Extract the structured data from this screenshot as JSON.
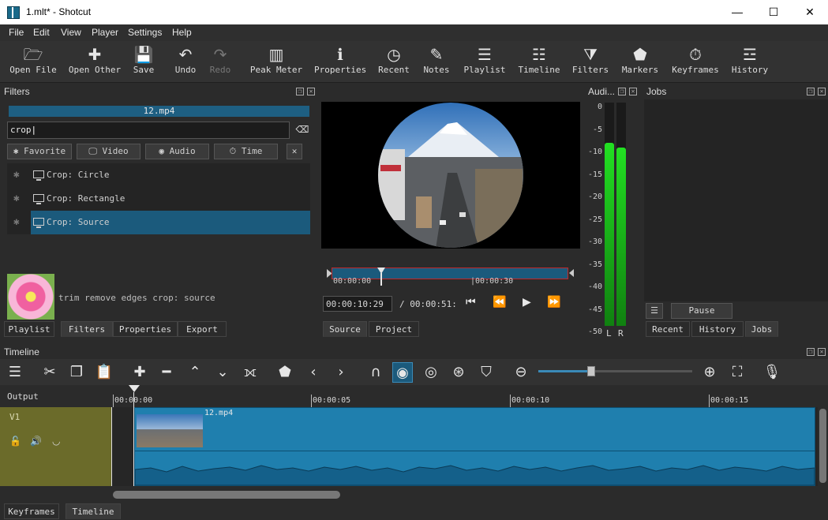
{
  "window": {
    "title": "1.mlt* - Shotcut",
    "minimize": "—",
    "maximize": "☐",
    "close": "✕"
  },
  "menu": [
    "File",
    "Edit",
    "View",
    "Player",
    "Settings",
    "Help"
  ],
  "toolbar": [
    {
      "label": "Open File",
      "icon": "folder-open-icon",
      "glyph": "🗁"
    },
    {
      "label": "Open Other",
      "icon": "open-other-icon",
      "glyph": "✚"
    },
    {
      "label": "Save",
      "icon": "save-icon",
      "glyph": "💾"
    },
    {
      "label": "Undo",
      "icon": "undo-icon",
      "glyph": "↶"
    },
    {
      "label": "Redo",
      "icon": "redo-icon",
      "glyph": "↷"
    },
    {
      "label": "Peak Meter",
      "icon": "peak-meter-icon",
      "glyph": "▥"
    },
    {
      "label": "Properties",
      "icon": "info-icon",
      "glyph": "ℹ"
    },
    {
      "label": "Recent",
      "icon": "clock-icon",
      "glyph": "◷"
    },
    {
      "label": "Notes",
      "icon": "notes-icon",
      "glyph": "✎"
    },
    {
      "label": "Playlist",
      "icon": "playlist-icon",
      "glyph": "☰"
    },
    {
      "label": "Timeline",
      "icon": "timeline-icon",
      "glyph": "☷"
    },
    {
      "label": "Filters",
      "icon": "funnel-icon",
      "glyph": "⧩"
    },
    {
      "label": "Markers",
      "icon": "marker-icon",
      "glyph": "⬟"
    },
    {
      "label": "Keyframes",
      "icon": "stopwatch-icon",
      "glyph": "⏱"
    },
    {
      "label": "History",
      "icon": "history-icon",
      "glyph": "☲"
    }
  ],
  "filters": {
    "title": "Filters",
    "clip_name": "12.mp4",
    "search_value": "crop",
    "chips": [
      "Favorite",
      "Video",
      "Audio",
      "Time"
    ],
    "close_chip": "✕",
    "items": [
      {
        "name": "Crop: Circle"
      },
      {
        "name": "Crop: Rectangle"
      },
      {
        "name": "Crop: Source"
      }
    ],
    "description": "trim remove edges crop: source",
    "tabs": [
      "Playlist",
      "Filters",
      "Properties",
      "Export"
    ]
  },
  "player": {
    "start_time": "00:00:00",
    "mid_time": "|00:00:30",
    "current_time": "00:00:10:29",
    "duration": "/ 00:00:51:",
    "tabs": [
      "Source",
      "Project"
    ]
  },
  "audio": {
    "title": "Audi...",
    "scale": [
      "0",
      "-5",
      "-10",
      "-15",
      "-20",
      "-25",
      "-30",
      "-35",
      "-40",
      "-45",
      "-50"
    ],
    "left_label": "L",
    "right_label": "R",
    "left_level": 0.82,
    "right_level": 0.8
  },
  "jobs": {
    "title": "Jobs",
    "pause_label": "Pause",
    "tabs": [
      "Recent",
      "History",
      "Jobs"
    ]
  },
  "timeline": {
    "title": "Timeline",
    "output_label": "Output",
    "track_name": "V1",
    "ruler": [
      "00:00:00",
      "00:00:05",
      "00:00:10",
      "00:00:15"
    ],
    "clip_name": "12.mp4"
  },
  "bottom_tabs": [
    "Keyframes",
    "Timeline"
  ]
}
